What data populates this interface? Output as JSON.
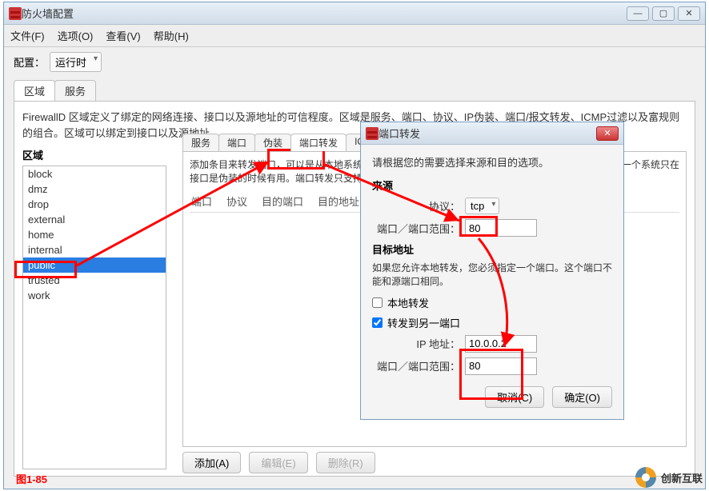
{
  "mainWindow": {
    "title": "防火墙配置",
    "menu": {
      "file": "文件(F)",
      "options": "选项(O)",
      "view": "查看(V)",
      "help": "帮助(H)"
    },
    "configLabel": "配置：",
    "configValue": "运行时",
    "tabs": {
      "zones": "区域",
      "services": "服务"
    },
    "desc": "FirewallD 区域定义了绑定的网络连接、接口以及源地址的可信程度。区域是服务、端口、协议、IP伪装、端口/报文转发、ICMP过滤以及富规则的组合。区域可以绑定到接口以及源地址。",
    "zonesLabel": "区域",
    "zones": [
      "block",
      "dmz",
      "drop",
      "external",
      "home",
      "internal",
      "public",
      "trusted",
      "work"
    ],
    "selectedZone": "public",
    "subtabs": {
      "svc": "服务",
      "port": "端口",
      "masq": "伪装",
      "fwd": "端口转发",
      "icmp": "ICMP"
    },
    "fwdDesc1": "添加条目来转发端口，可以是从本地系统到另一个本地端口，或者从本地系统到另一个系统。转发到另一个系统只在接口是伪装的时候有用。端口转发只支持 IPv4。",
    "cols": {
      "port": "端口",
      "proto": "协议",
      "dport": "目的端口",
      "daddr": "目的地址"
    },
    "btns": {
      "add": "添加(A)",
      "edit": "编辑(E)",
      "del": "删除(R)"
    }
  },
  "dialog": {
    "title": "端口转发",
    "prompt": "请根据您的需要选择来源和目的选项。",
    "srcLabel": "来源",
    "protoLabel": "协议：",
    "protoValue": "tcp",
    "portLabel": "端口／端口范围：",
    "srcPort": "80",
    "dstLabel": "目标地址",
    "dstNote": "如果您允许本地转发，您必须指定一个端口。这个端口不能和源端口相同。",
    "localFwd": "本地转发",
    "fwdOther": "转发到另一端口",
    "ipLabel": "IP 地址：",
    "ipValue": "10.0.0.2",
    "dstPort": "80",
    "cancel": "取消(C)",
    "ok": "确定(O)"
  },
  "fig": "图1-85",
  "brand": "创新互联"
}
